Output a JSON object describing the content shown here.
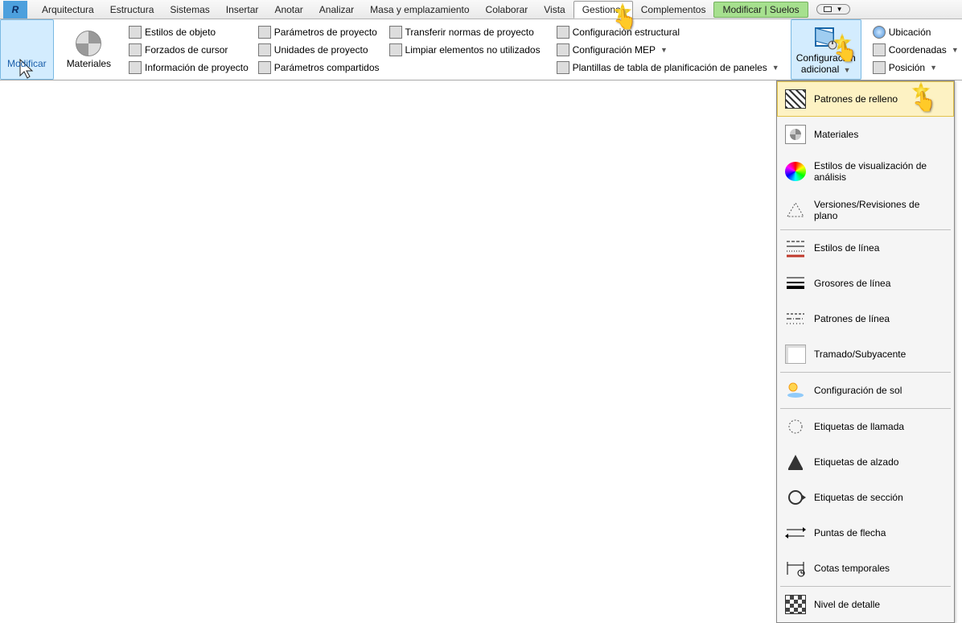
{
  "menu": {
    "items": [
      "Arquitectura",
      "Estructura",
      "Sistemas",
      "Insertar",
      "Anotar",
      "Analizar",
      "Masa y emplazamiento",
      "Colaborar",
      "Vista",
      "Gestionar",
      "Complementos",
      "Modificar | Suelos"
    ]
  },
  "mod": {
    "label": "Modificar"
  },
  "mat": {
    "label": "Materiales"
  },
  "settings": {
    "r1": [
      "Estilos de objeto",
      "Parámetros de proyecto",
      "Transferir normas de proyecto"
    ],
    "r2": [
      "Forzados de cursor",
      "Unidades de proyecto",
      "Limpiar elementos no utilizados"
    ],
    "r3": [
      "Información de proyecto",
      "Parámetros compartidos"
    ]
  },
  "cfg": {
    "structural": "Configuración estructural",
    "mep": "Configuración MEP",
    "panels": "Plantillas de tabla de planificación de paneles"
  },
  "addl": {
    "l1": "Configuración",
    "l2": "adicional"
  },
  "loc": {
    "a": "Ubicación",
    "b": "Coordenadas",
    "c": "Posición"
  },
  "dd": {
    "i0": "Patrones de relleno",
    "i1": "Materiales",
    "i2": "Estilos de visualización de análisis",
    "i3": "Versiones/Revisiones de plano",
    "i4": "Estilos de línea",
    "i5": "Grosores de línea",
    "i6": "Patrones de línea",
    "i7": "Tramado/Subyacente",
    "i8": "Configuración de sol",
    "i9": "Etiquetas de llamada",
    "i10": "Etiquetas de alzado",
    "i11": "Etiquetas de sección",
    "i12": "Puntas de flecha",
    "i13": "Cotas temporales",
    "i14": "Nivel de detalle"
  }
}
